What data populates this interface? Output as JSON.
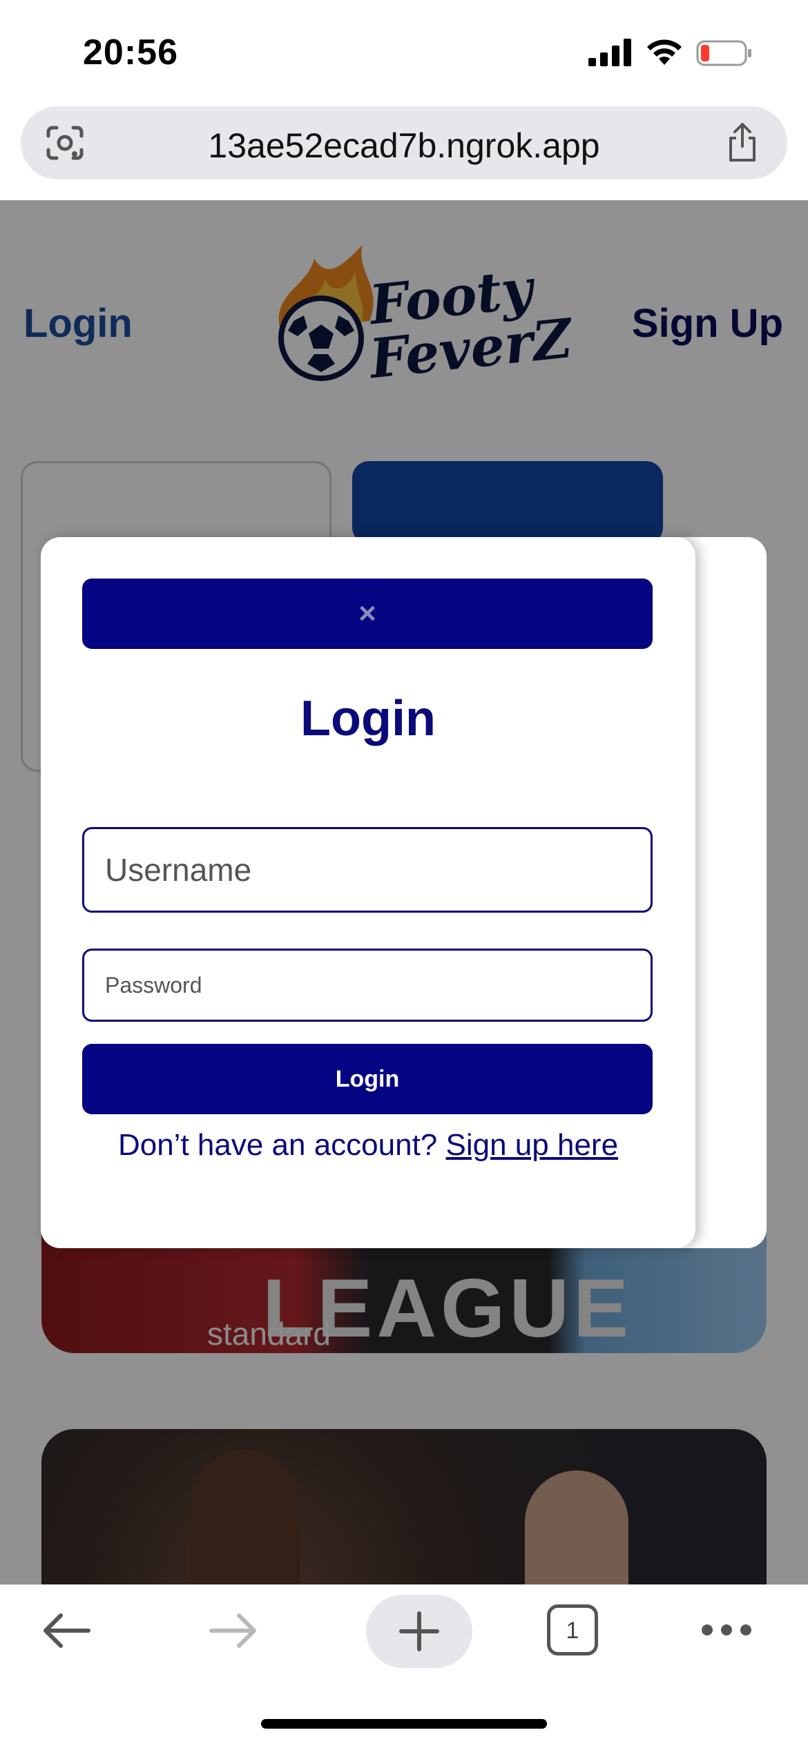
{
  "status_bar": {
    "time": "20:56"
  },
  "browser": {
    "url": "13ae52ecad7b.ngrok.app"
  },
  "site": {
    "nav_login": "Login",
    "nav_signup": "Sign Up",
    "logo_line_1": "Footy",
    "logo_line_2": "FeverZ",
    "banner_1_text": "LEAGUE",
    "banner_1_sponsor": "standard"
  },
  "modal": {
    "close_symbol": "×",
    "title": "Login",
    "username_placeholder": "Username",
    "password_placeholder": "Password",
    "submit_label": "Login",
    "signup_prompt": "Don’t have an account?",
    "signup_link": "Sign up here"
  },
  "toolbar": {
    "tab_count": "1"
  },
  "colors": {
    "modal_primary": "#050583",
    "nav_login": "#1a4c9e",
    "nav_signup": "#0a0f5a"
  },
  "icons": [
    "lens-icon",
    "share-icon",
    "back-icon",
    "forward-icon",
    "plus-icon",
    "more-icon",
    "signal-icon",
    "wifi-icon",
    "battery-icon",
    "soccer-ball-icon"
  ]
}
